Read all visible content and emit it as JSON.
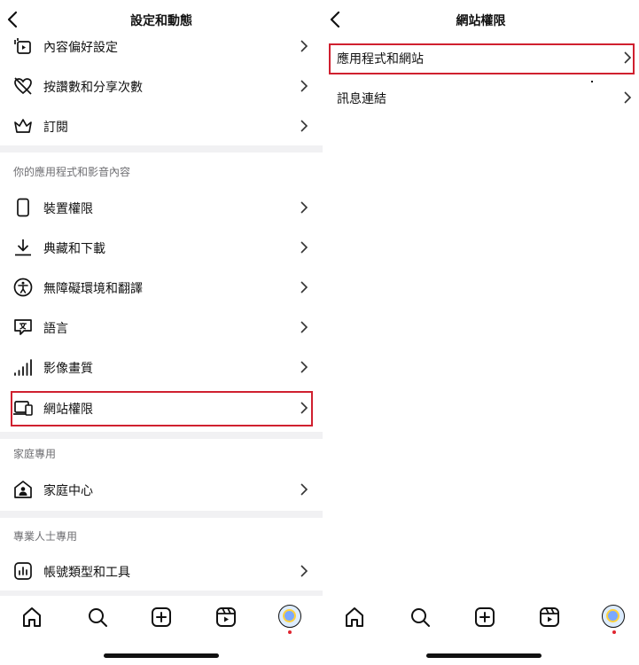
{
  "left": {
    "title": "設定和動態",
    "items_top": [
      {
        "label": "內容偏好設定",
        "icon": "content-preferences-icon"
      },
      {
        "label": "按讚數和分享次數",
        "icon": "heart-off-icon"
      },
      {
        "label": "訂閱",
        "icon": "crown-icon"
      }
    ],
    "section_apps": "你的應用程式和影音內容",
    "items_apps": [
      {
        "label": "裝置權限",
        "icon": "phone-icon"
      },
      {
        "label": "典藏和下載",
        "icon": "download-icon"
      },
      {
        "label": "無障礙環境和翻譯",
        "icon": "accessibility-icon"
      },
      {
        "label": "語言",
        "icon": "language-icon"
      },
      {
        "label": "影像畫質",
        "icon": "signal-bars-icon"
      },
      {
        "label": "網站權限",
        "icon": "devices-icon"
      }
    ],
    "section_family": "家庭專用",
    "items_family": [
      {
        "label": "家庭中心",
        "icon": "family-home-icon"
      }
    ],
    "section_pro": "專業人士專用",
    "items_pro": [
      {
        "label": "帳號類型和工具",
        "icon": "chart-icon"
      }
    ]
  },
  "right": {
    "title": "網站權限",
    "items": [
      {
        "label": "應用程式和網站"
      },
      {
        "label": "訊息連結"
      }
    ]
  },
  "tabs": [
    "home-icon",
    "search-icon",
    "create-icon",
    "reels-icon",
    "profile-avatar"
  ],
  "colors": {
    "highlight": "#d0202f",
    "notification_dot": "#e0242f",
    "section_bg": "#f1f1f3",
    "section_text": "#6f6f73"
  }
}
